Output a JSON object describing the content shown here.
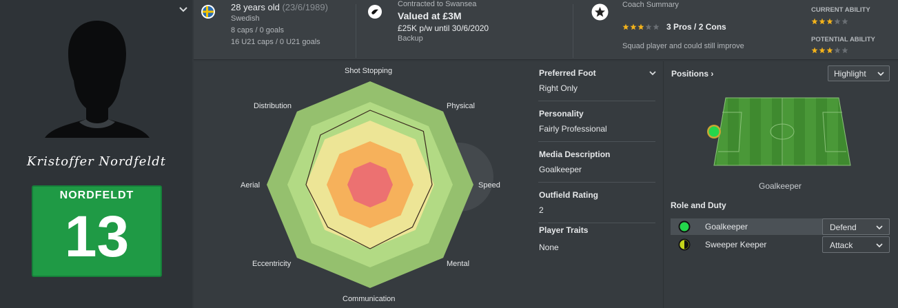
{
  "profile": {
    "signature": "Kristoffer Nordfeldt",
    "shirt": {
      "name": "NORDFELDT",
      "number": "13"
    }
  },
  "header": {
    "age": "28 years old",
    "dob": "(23/6/1989)",
    "nationality": "Swedish",
    "caps": "8 caps / 0 goals",
    "u21_caps": "16 U21 caps / 0 U21 goals",
    "contract_label": "Contracted to Swansea",
    "value": "Valued at £3M",
    "wage": "£25K p/w until 30/6/2020",
    "squad_status": "Backup",
    "coach_summary_label": "Coach Summary",
    "pros_cons": "3 Pros / 2 Cons",
    "coach_note": "Squad player and could still improve",
    "current_ability_label": "CURRENT ABILITY",
    "potential_ability_label": "POTENTIAL ABILITY",
    "star_rating": 3,
    "star_max": 5
  },
  "radar": {
    "labels": {
      "shot_stopping": "Shot Stopping",
      "physical": "Physical",
      "speed": "Speed",
      "mental": "Mental",
      "communication": "Communication",
      "eccentricity": "Eccentricity",
      "aerial": "Aerial",
      "distribution": "Distribution"
    },
    "values": [
      0.72,
      0.73,
      0.6,
      0.58,
      0.62,
      0.58,
      0.62,
      0.68
    ],
    "band_colors": [
      "#95c06e",
      "#b2da84",
      "#ede596",
      "#f6b15b",
      "#ec7171"
    ]
  },
  "details": {
    "preferred_foot_label": "Preferred Foot",
    "preferred_foot": "Right Only",
    "personality_label": "Personality",
    "personality": "Fairly Professional",
    "media_label": "Media Description",
    "media": "Goalkeeper",
    "outfield_label": "Outfield Rating",
    "outfield": "2",
    "traits_label": "Player Traits",
    "traits": "None"
  },
  "positions": {
    "title": "Positions",
    "highlight_label": "Highlight",
    "position_name": "Goalkeeper",
    "role_duty_title": "Role and Duty",
    "roles": [
      {
        "role": "Goalkeeper",
        "duty": "Defend"
      },
      {
        "role": "Sweeper Keeper",
        "duty": "Attack"
      }
    ]
  },
  "colors": {
    "accent_star": "#f2b21b",
    "pitch_green": "#3f8a2f",
    "position_dot": "#24d64c"
  }
}
